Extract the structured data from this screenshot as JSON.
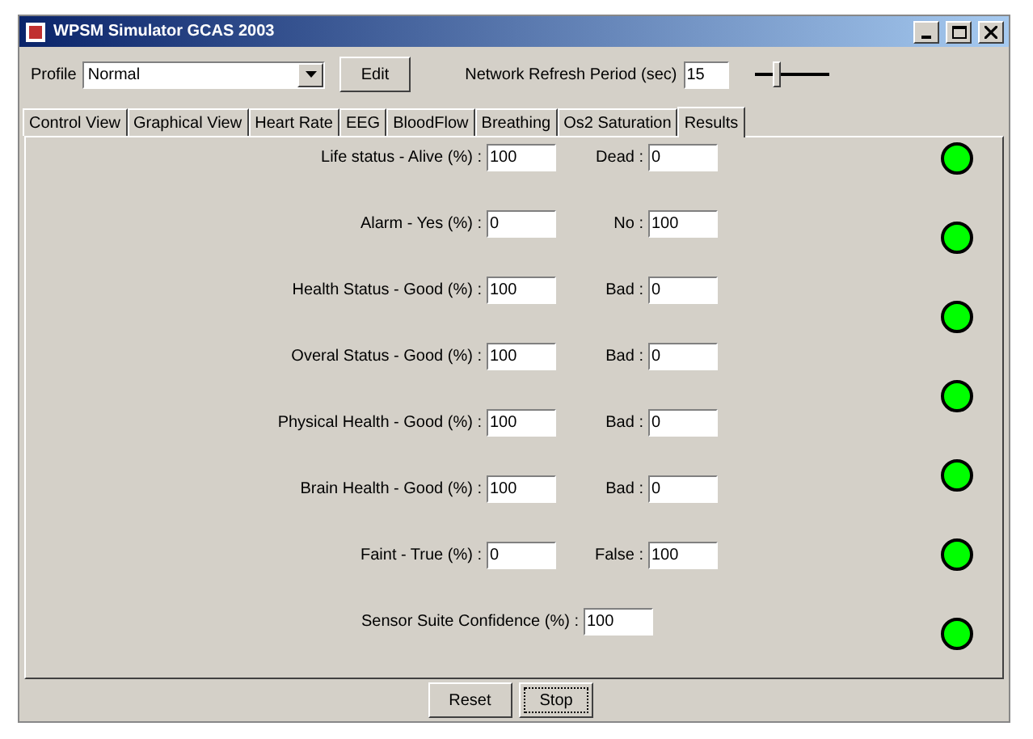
{
  "window": {
    "title": "WPSM Simulator GCAS 2003"
  },
  "profile": {
    "label": "Profile",
    "value": "Normal"
  },
  "edit_button": "Edit",
  "refresh": {
    "label": "Network Refresh Period (sec)",
    "value": "15",
    "level": 0.3
  },
  "tabs": [
    {
      "label": "Control View",
      "selected": false
    },
    {
      "label": "Graphical View",
      "selected": false
    },
    {
      "label": "Heart Rate",
      "selected": false
    },
    {
      "label": "EEG",
      "selected": false
    },
    {
      "label": "BloodFlow",
      "selected": false
    },
    {
      "label": "Breathing",
      "selected": false
    },
    {
      "label": "Os2 Saturation",
      "selected": false
    },
    {
      "label": "Results",
      "selected": true
    }
  ],
  "results": [
    {
      "label": "Life status - Alive (%) :",
      "value": "100",
      "label_2": "Dead :",
      "value_2": "0"
    },
    {
      "label": "Alarm - Yes (%) :",
      "value": "0",
      "label_2": "No :",
      "value_2": "100"
    },
    {
      "label": "Health Status - Good (%) :",
      "value": "100",
      "label_2": "Bad :",
      "value_2": "0"
    },
    {
      "label": "Overal Status - Good (%) :",
      "value": "100",
      "label_2": "Bad :",
      "value_2": "0"
    },
    {
      "label": "Physical Health - Good (%) :",
      "value": "100",
      "label_2": "Bad :",
      "value_2": "0"
    },
    {
      "label": "Brain Health - Good (%) :",
      "value": "100",
      "label_2": "Bad :",
      "value_2": "0"
    },
    {
      "label": "Faint - True (%) :",
      "value": "0",
      "label_2": "False :",
      "value_2": "100"
    },
    {
      "label": "Sensor Suite Confidence (%) :",
      "value": "100"
    }
  ],
  "lights": [
    {
      "color": "#00ff00"
    },
    {
      "color": "#00ff00"
    },
    {
      "color": "#00ff00"
    },
    {
      "color": "#00ff00"
    },
    {
      "color": "#00ff00"
    },
    {
      "color": "#00ff00"
    },
    {
      "color": "#00ff00"
    }
  ],
  "buttons": [
    {
      "label": "Reset",
      "focused": false
    },
    {
      "label": "Stop",
      "focused": true
    }
  ]
}
